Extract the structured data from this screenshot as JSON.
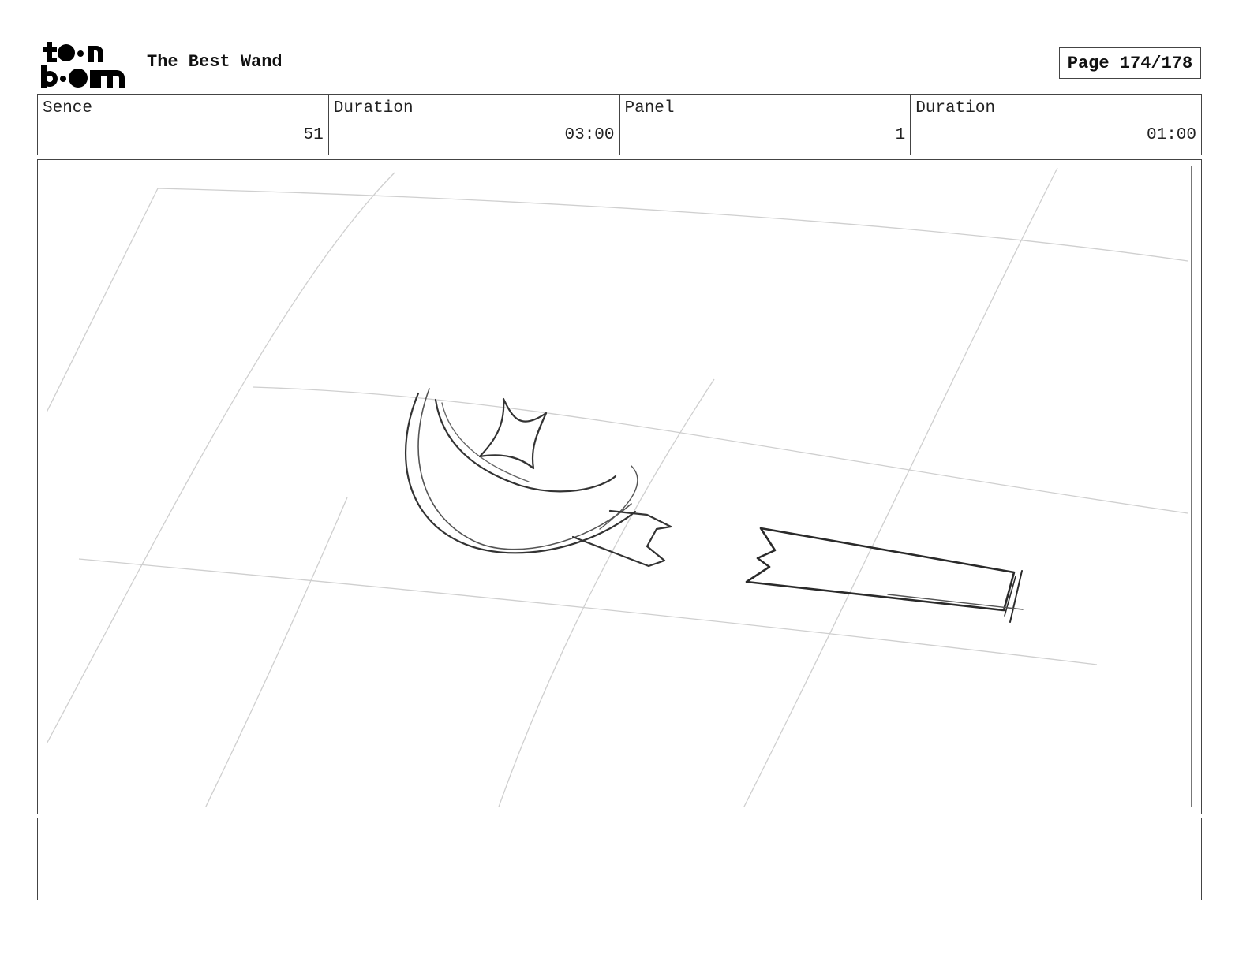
{
  "header": {
    "logo_lines": [
      "toon",
      "boom"
    ],
    "project_title": "The Best Wand",
    "page_label": "Page 174/178"
  },
  "info": {
    "scene_label": "Sence",
    "scene_value": "51",
    "scene_duration_label": "Duration",
    "scene_duration_value": "03:00",
    "panel_label": "Panel",
    "panel_value": "1",
    "panel_duration_label": "Duration",
    "panel_duration_value": "01:00"
  },
  "panel": {
    "sketch_description_icon": "broken-wand-sketch"
  },
  "notes": {
    "text": ""
  }
}
